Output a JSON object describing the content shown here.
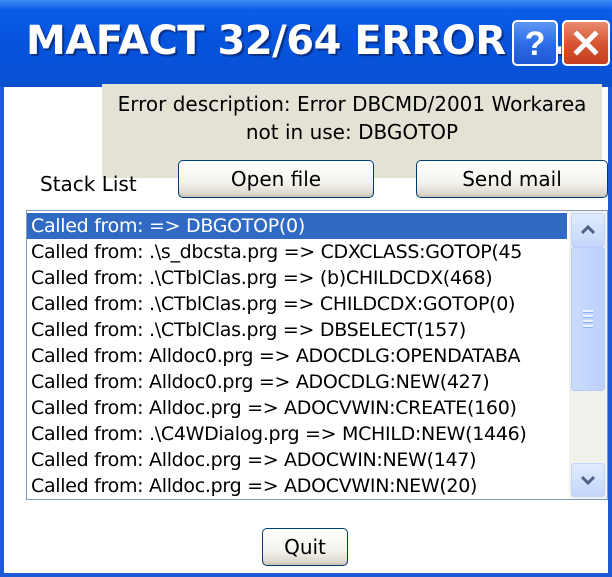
{
  "window": {
    "title": "MAFACT 32/64 ERROR R...",
    "help_label": "?",
    "close_label": "X"
  },
  "error": {
    "description_line1": "Error description: Error DBCMD/2001  Workarea",
    "description_line2": "not in use: DBGOTOP"
  },
  "stack": {
    "label": "Stack List",
    "items": [
      "Called from:  => DBGOTOP(0)",
      "Called from: .\\s_dbcsta.prg => CDXCLASS:GOTOP(45",
      "Called from: .\\CTblClas.prg => (b)CHILDCDX(468)",
      "Called from: .\\CTblClas.prg => CHILDCDX:GOTOP(0)",
      "Called from: .\\CTblClas.prg => DBSELECT(157)",
      "Called from: Alldoc0.prg => ADOCDLG:OPENDATABA",
      "Called from: Alldoc0.prg => ADOCDLG:NEW(427)",
      "Called from: Alldoc.prg => ADOCVWIN:CREATE(160)",
      "Called from: .\\C4WDialog.prg => MCHILD:NEW(1446)",
      "Called from: Alldoc.prg => ADOCWIN:NEW(147)",
      "Called from: Alldoc.prg => ADOCVWIN:NEW(20)"
    ],
    "selected_index": 0
  },
  "buttons": {
    "open_file": "Open file",
    "send_mail": "Send mail",
    "quit": "Quit"
  },
  "icons": {
    "help": "help-icon",
    "close": "close-icon",
    "scroll_up": "chevron-up-icon",
    "scroll_down": "chevron-down-icon"
  },
  "colors": {
    "titlebar": "#0653dc",
    "selection": "#316ac5",
    "close_button": "#d5532f",
    "description_background": "#e4e2d4"
  }
}
